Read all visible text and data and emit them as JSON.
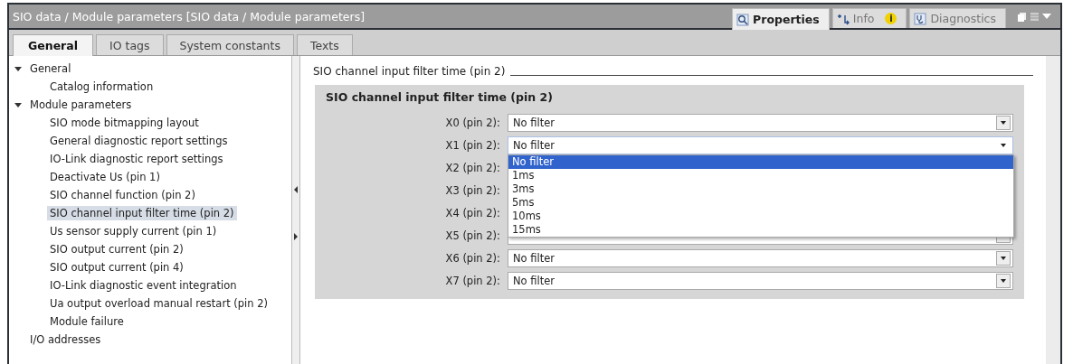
{
  "window": {
    "title": "SIO data / Module parameters [SIO data / Module parameters]"
  },
  "view_tabs": [
    {
      "label": "Properties",
      "kind": "magnifier",
      "selected": true
    },
    {
      "label": "Info",
      "kind": "info",
      "badge": "i",
      "selected": false
    },
    {
      "label": "Diagnostics",
      "kind": "stethoscope",
      "selected": false
    }
  ],
  "tabs": [
    {
      "label": "General",
      "selected": true
    },
    {
      "label": "IO tags",
      "selected": false
    },
    {
      "label": "System constants",
      "selected": false
    },
    {
      "label": "Texts",
      "selected": false
    }
  ],
  "sidebar": {
    "items": [
      {
        "label": "General",
        "expanded": true,
        "selected": false,
        "children": [
          {
            "label": "Catalog information",
            "selected": false
          }
        ]
      },
      {
        "label": "Module parameters",
        "expanded": true,
        "selected": false,
        "children": [
          {
            "label": "SIO mode bitmapping layout",
            "selected": false
          },
          {
            "label": "General diagnostic report settings",
            "selected": false
          },
          {
            "label": "IO-Link diagnostic report settings",
            "selected": false
          },
          {
            "label": "Deactivate Us (pin 1)",
            "selected": false
          },
          {
            "label": "SIO channel function (pin 2)",
            "selected": false
          },
          {
            "label": "SIO channel input filter time (pin 2)",
            "selected": true
          },
          {
            "label": "Us sensor supply current (pin 1)",
            "selected": false
          },
          {
            "label": "SIO output current (pin 2)",
            "selected": false
          },
          {
            "label": "SIO output current (pin 4)",
            "selected": false
          },
          {
            "label": "IO-Link diagnostic event integration",
            "selected": false
          },
          {
            "label": "Ua output overload manual restart (pin 2)",
            "selected": false
          },
          {
            "label": "Module failure",
            "selected": false
          }
        ]
      },
      {
        "label": "I/O addresses",
        "selected": false
      }
    ]
  },
  "section": {
    "title": "SIO channel input filter time (pin 2)",
    "group_title": "SIO channel input filter time (pin 2)",
    "rows": [
      {
        "label": "X0 (pin 2):",
        "value": "No filter"
      },
      {
        "label": "X1 (pin 2):",
        "value": "No filter",
        "options": [
          {
            "label": "No filter",
            "selected": true
          },
          {
            "label": "1ms",
            "selected": false
          },
          {
            "label": "3ms",
            "selected": false
          },
          {
            "label": "5ms",
            "selected": false
          },
          {
            "label": "10ms",
            "selected": false
          },
          {
            "label": "15ms",
            "selected": false
          }
        ]
      },
      {
        "label": "X2 (pin 2):"
      },
      {
        "label": "X3 (pin 2):"
      },
      {
        "label": "X4 (pin 2):"
      },
      {
        "label": "X5 (pin 2):"
      },
      {
        "label": "X6 (pin 2):",
        "value": "No filter"
      },
      {
        "label": "X7 (pin 2):",
        "value": "No filter"
      }
    ]
  }
}
